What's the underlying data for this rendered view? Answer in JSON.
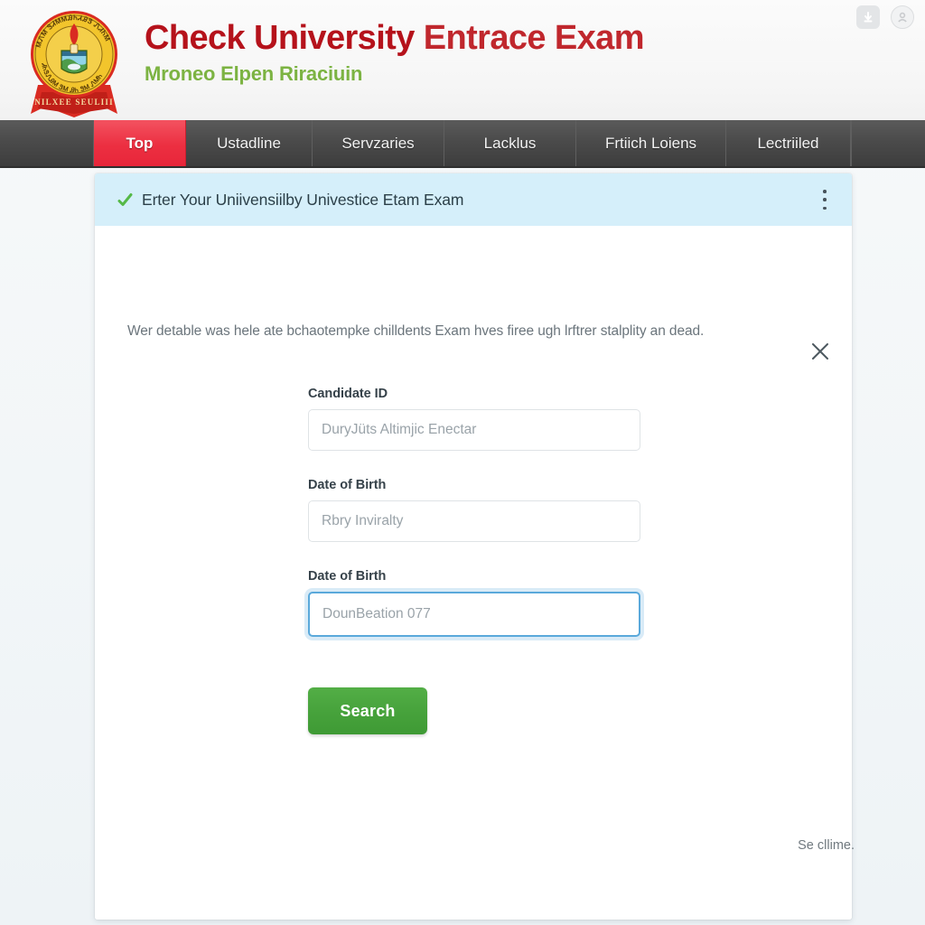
{
  "header": {
    "title_part1": "Check University ",
    "title_part2": "Entrace Exam",
    "subtitle": "Mroneo Elpen Riraciuin",
    "logo_name": "university-crest",
    "icons": [
      {
        "name": "download-icon",
        "glyph": "download"
      },
      {
        "name": "avatar-circle-icon",
        "glyph": "person"
      }
    ]
  },
  "nav": {
    "items": [
      {
        "label": "Top",
        "active": true
      },
      {
        "label": "Ustadline",
        "active": false
      },
      {
        "label": "Servzaries",
        "active": false
      },
      {
        "label": "Lacklus",
        "active": false
      },
      {
        "label": "Frtiich Loiens",
        "active": false
      },
      {
        "label": "Lectriiled",
        "active": false
      }
    ]
  },
  "card": {
    "banner": {
      "title": "Erter Your Uniivensiilby Univestice Etam Exam",
      "check_icon": "green-check-icon",
      "menu_icon": "kebab-menu-icon"
    },
    "close_icon": "close-icon",
    "lede": "Wer detable was hele ate bchaotempke chilldents Exam hves firee ugh lrftrer stalplity an dead.",
    "fields": [
      {
        "label": "Candidate ID",
        "placeholder": "DuryJüts Altimjic Enectar",
        "value": "",
        "focused": false,
        "name": "candidate-id-input"
      },
      {
        "label": "Date of Birth",
        "placeholder": "Rbry Inviralty",
        "value": "",
        "focused": false,
        "name": "date-of-birth-input"
      },
      {
        "label": "Date of Birth",
        "placeholder": "DounBeation 077",
        "value": "",
        "focused": true,
        "name": "date-of-birth-secondary-input"
      }
    ],
    "submit_label": "Search"
  },
  "footer": {
    "note": "Se cllime."
  },
  "colors": {
    "brand_red": "#b5121b",
    "brand_green": "#7cb342",
    "nav_bar": "#4a4a4a",
    "nav_active": "#ec2f41",
    "banner_blue": "#d5effa",
    "button_green": "#46a23b",
    "focus_blue": "#5aa9db",
    "page_bg": "#f2f6f8"
  }
}
